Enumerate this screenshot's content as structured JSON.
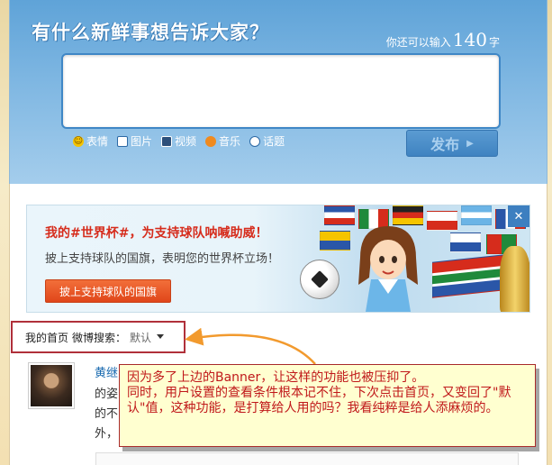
{
  "publisher": {
    "title": "有什么新鲜事想告诉大家？",
    "count_prefix": "你还可以输入",
    "count_value": "140",
    "count_suffix": "字",
    "tools": [
      {
        "label": "表情",
        "icon": "smile-icon"
      },
      {
        "label": "图片",
        "icon": "picture-icon"
      },
      {
        "label": "视频",
        "icon": "video-icon"
      },
      {
        "label": "音乐",
        "icon": "music-icon"
      },
      {
        "label": "话题",
        "icon": "topic-icon"
      }
    ],
    "publish_label": "发布",
    "publish_arrow": "▶"
  },
  "banner": {
    "title": "我的#世界杯#，为支持球队呐喊助威！",
    "subtitle": "披上支持球队的国旗，表明您的世界杯立场！",
    "button_label": "披上支持球队的国旗",
    "close_label": "✕"
  },
  "sortbar": {
    "home_label": "我的首页",
    "search_label": "微博搜索：",
    "search_value": "默认"
  },
  "feed": {
    "author": "黄继",
    "line1": "的姿",
    "line2": "的不",
    "line3": "外，"
  },
  "annotation": {
    "line1": "因为多了上边的Banner，让这样的功能也被压抑了。",
    "line2": "同时，用户设置的查看条件根本记不住，下次点击首页，又变回了\"默认\"值，这种功能，是打算给人用的吗？我看纯粹是给人添麻烦的。"
  },
  "colors": {
    "publisher_bg": "#7fb7e2",
    "banner_title": "#d62c1c",
    "banner_button": "#e0461a",
    "annotation_border": "#a82a2a",
    "annotation_text": "#c0181a",
    "arrow": "#f29a2e"
  }
}
